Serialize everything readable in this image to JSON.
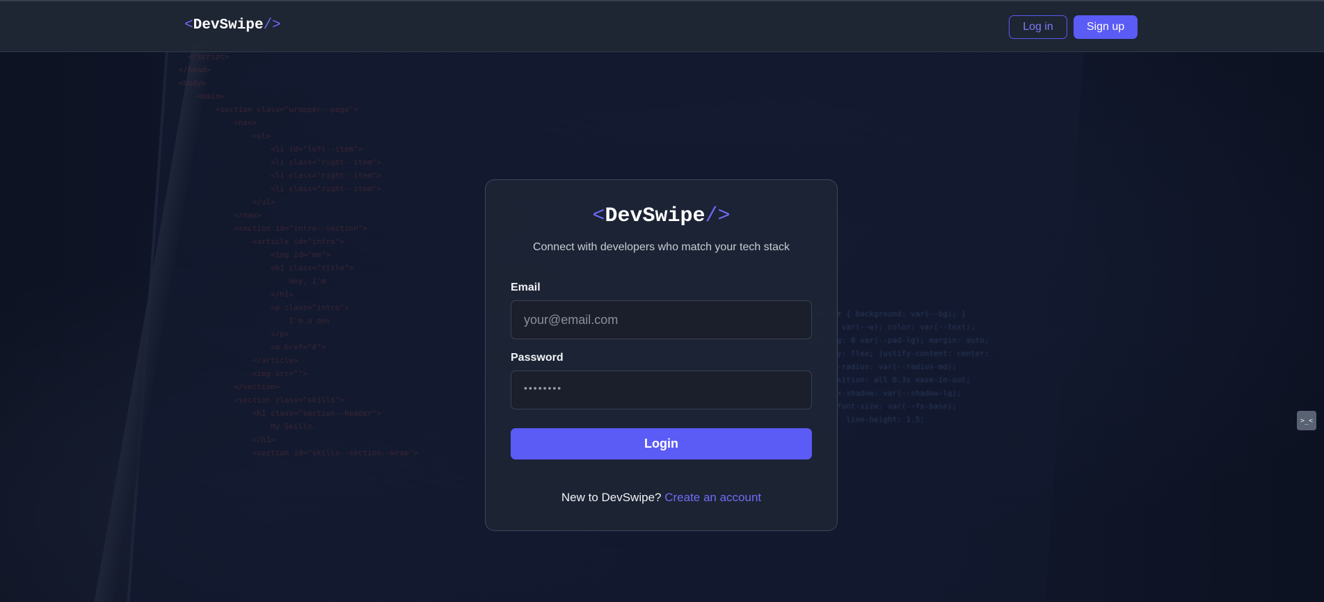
{
  "header": {
    "logo": {
      "open": "<",
      "name": "DevSwipe",
      "close": "/>"
    },
    "login_label": "Log in",
    "signup_label": "Sign up"
  },
  "card": {
    "logo": {
      "open": "<",
      "name": "DevSwipe",
      "close": "/>"
    },
    "tagline": "Connect with developers who match your tech stack",
    "email": {
      "label": "Email",
      "placeholder": "your@email.com",
      "value": ""
    },
    "password": {
      "label": "Password",
      "masked_value": "••••••••"
    },
    "submit_label": "Login",
    "footer": {
      "prompt": "New to DevSwipe?",
      "link_label": "Create an account"
    }
  },
  "side_widget": {
    "icon": "terminal-icon",
    "glyph": ">_<"
  },
  "colors": {
    "accent": "#5b5bf6",
    "header_bg": "#1f2634",
    "card_bg": "#1e2434",
    "input_bg": "#1a1f2b"
  }
}
